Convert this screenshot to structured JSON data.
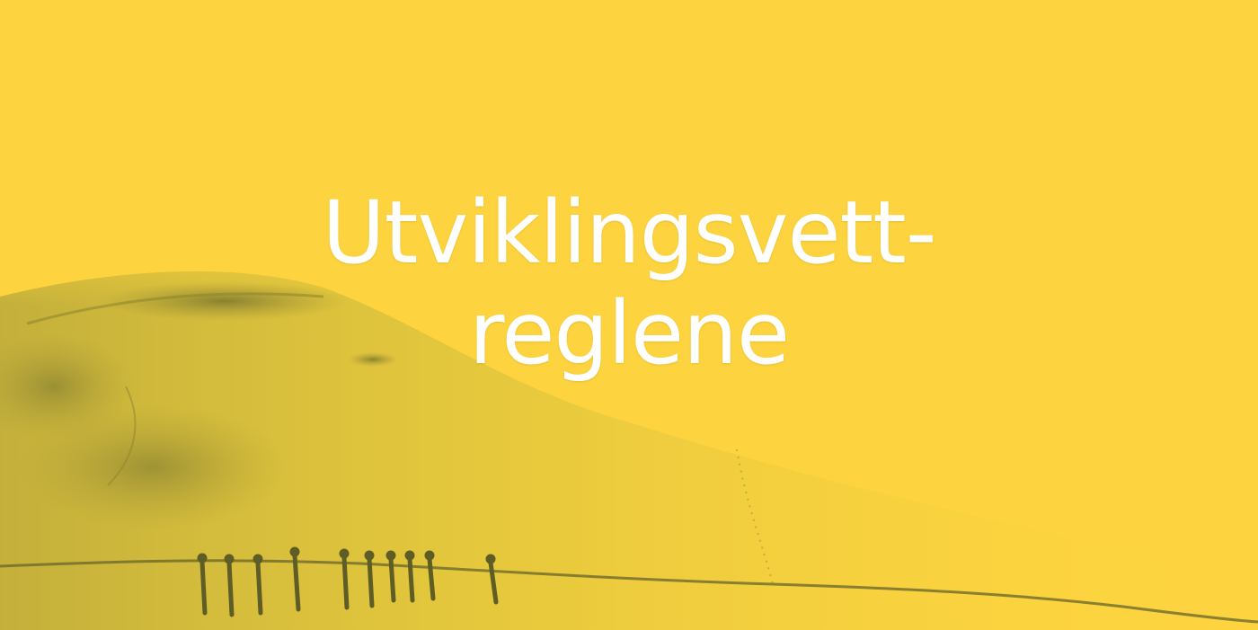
{
  "hero": {
    "title_line_1": "Utviklingsvett-",
    "title_line_2": "reglene",
    "background_color": "#fdd43f",
    "image": "aerial snow landscape with a line of skiers, yellow duotone"
  }
}
